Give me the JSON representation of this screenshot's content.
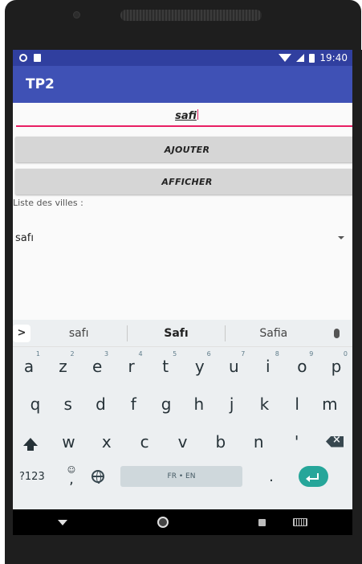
{
  "status_bar": {
    "time": "19:40"
  },
  "app_bar": {
    "title": "TP2"
  },
  "form": {
    "city_input_value": "safi",
    "add_button_label": "AJOUTER",
    "show_button_label": "AFFICHER",
    "list_label": "Liste des villes :",
    "spinner_selected": "safı"
  },
  "keyboard": {
    "suggestions": [
      "safı",
      "Safı",
      "Safia"
    ],
    "row1": [
      {
        "key": "a",
        "hint": "1"
      },
      {
        "key": "z",
        "hint": "2"
      },
      {
        "key": "e",
        "hint": "3"
      },
      {
        "key": "r",
        "hint": "4"
      },
      {
        "key": "t",
        "hint": "5"
      },
      {
        "key": "y",
        "hint": "6"
      },
      {
        "key": "u",
        "hint": "7"
      },
      {
        "key": "i",
        "hint": "8"
      },
      {
        "key": "o",
        "hint": "9"
      },
      {
        "key": "p",
        "hint": "0"
      }
    ],
    "row2": [
      "q",
      "s",
      "d",
      "f",
      "g",
      "h",
      "j",
      "k",
      "l",
      "m"
    ],
    "row3": [
      "w",
      "x",
      "c",
      "v",
      "b",
      "n",
      "'"
    ],
    "symbols_key": "?123",
    "comma_key": ",",
    "space_label": "FR • EN",
    "period_key": "."
  },
  "icons": {
    "accent": "#3f51b5",
    "status_bar": "#303f9f",
    "input_underline": "#e91e63",
    "enter_key": "#26a69a"
  }
}
